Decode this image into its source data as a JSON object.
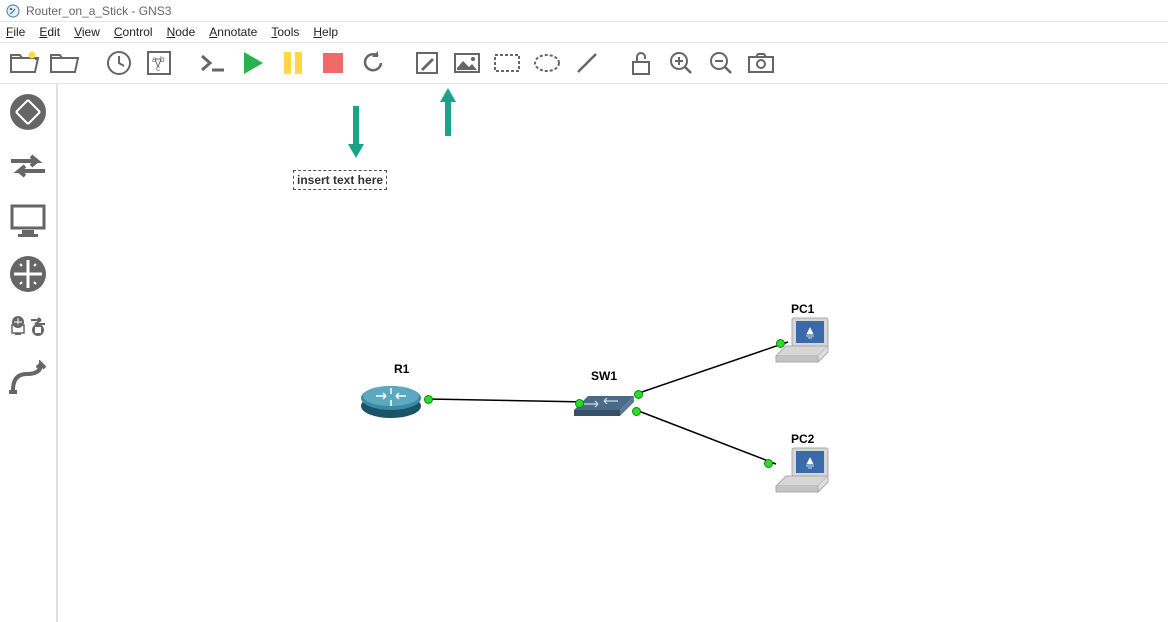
{
  "window": {
    "title": "Router_on_a_Stick - GNS3"
  },
  "menu": {
    "file": "File",
    "edit": "Edit",
    "view": "View",
    "control": "Control",
    "node": "Node",
    "annotate": "Annotate",
    "tools": "Tools",
    "help": "Help"
  },
  "toolbar": {
    "new_project": "new-project",
    "open_project": "open-project",
    "snapshot": "snapshot",
    "show_labels": "show-labels",
    "console": "console-all",
    "start": "start-all",
    "pause": "pause-all",
    "stop": "stop-all",
    "reload": "reload-all",
    "add_note": "add-note",
    "insert_picture": "insert-picture",
    "rectangle": "draw-rectangle",
    "ellipse": "draw-ellipse",
    "line": "draw-line",
    "lock": "lock-items",
    "zoom_in": "zoom-in",
    "zoom_out": "zoom-out",
    "screenshot": "screenshot"
  },
  "sidebar": {
    "routers": "routers",
    "switches": "switches",
    "end_devices": "end-devices",
    "security": "security-devices",
    "all_devices": "all-devices",
    "add_link": "add-link"
  },
  "canvas": {
    "text_annotation": "insert text here",
    "nodes": {
      "r1": {
        "label": "R1"
      },
      "sw1": {
        "label": "SW1"
      },
      "pc1": {
        "label": "PC1"
      },
      "pc2": {
        "label": "PC2"
      }
    }
  }
}
